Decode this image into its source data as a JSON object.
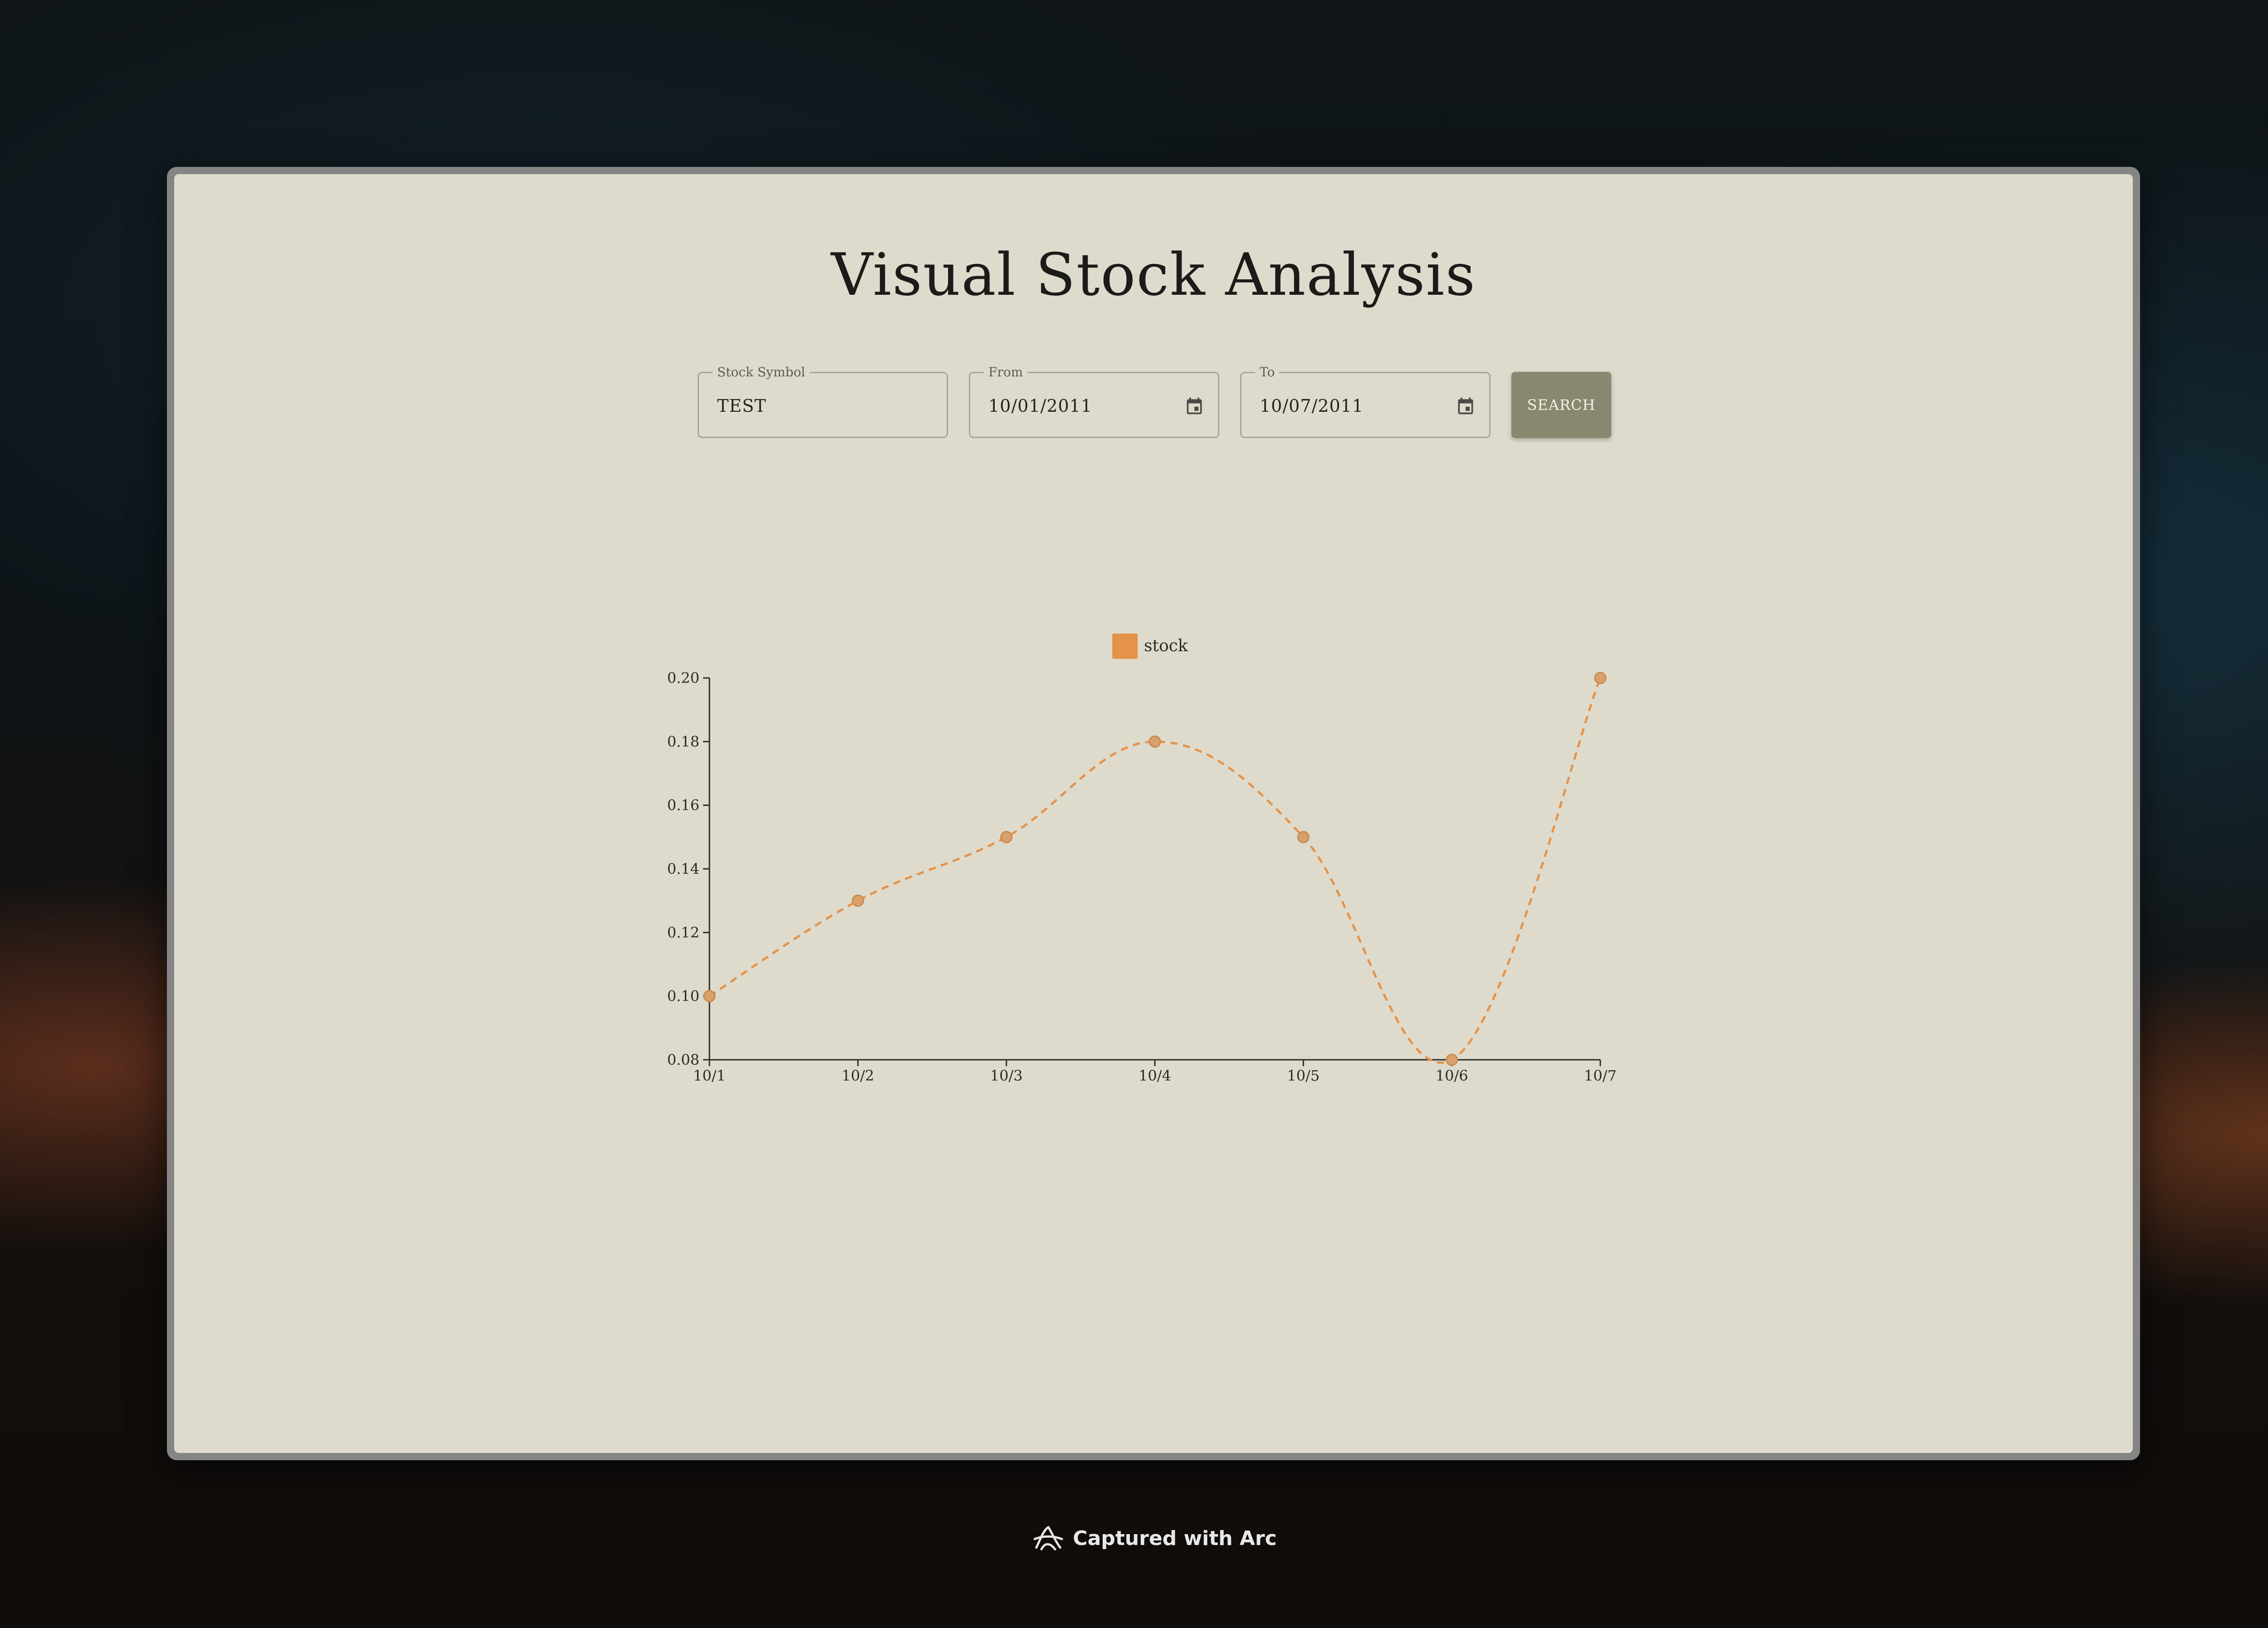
{
  "page": {
    "title": "Visual Stock Analysis"
  },
  "form": {
    "symbol": {
      "label": "Stock Symbol",
      "value": "TEST"
    },
    "from": {
      "label": "From",
      "value": "10/01/2011",
      "icon": "calendar-icon"
    },
    "to": {
      "label": "To",
      "value": "10/07/2011",
      "icon": "calendar-icon"
    },
    "search_label": "SEARCH"
  },
  "chart_data": {
    "type": "line",
    "title": "",
    "xlabel": "",
    "ylabel": "",
    "categories": [
      "10/1",
      "10/2",
      "10/3",
      "10/4",
      "10/5",
      "10/6",
      "10/7"
    ],
    "series": [
      {
        "name": "stock",
        "values": [
          0.1,
          0.13,
          0.15,
          0.18,
          0.15,
          0.08,
          0.2
        ],
        "color": "#e5934a"
      }
    ],
    "ylim": [
      0.08,
      0.2
    ],
    "yticks": [
      "0.08",
      "0.10",
      "0.12",
      "0.14",
      "0.16",
      "0.18",
      "0.20"
    ],
    "line_style": "dashed",
    "curve": "smooth",
    "grid": false,
    "legend": "top-center"
  },
  "footer": {
    "text": "Captured with Arc"
  },
  "colors": {
    "background": "#dedbcd",
    "accent": "#888870",
    "series": "#e5934a",
    "text": "#1b1b19"
  }
}
